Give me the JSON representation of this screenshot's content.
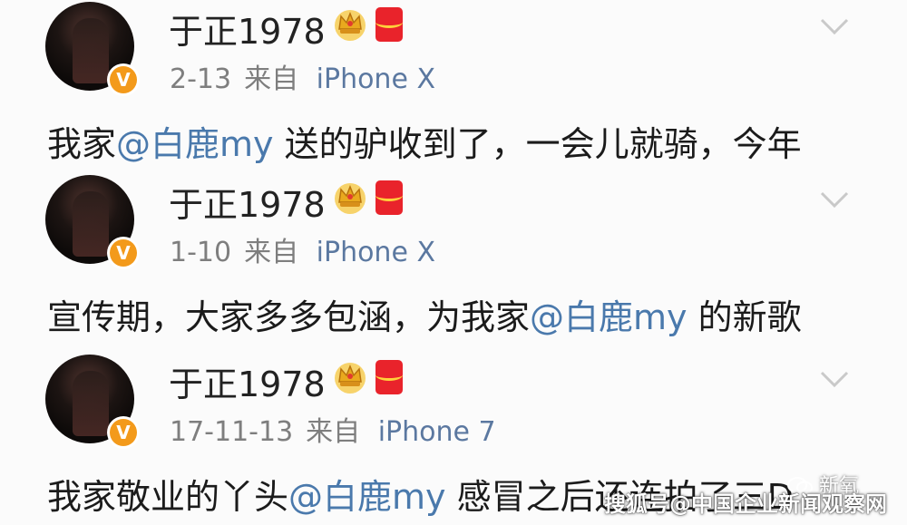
{
  "posts": [
    {
      "username": "于正1978",
      "date": "2-13",
      "source_prefix": "来自",
      "device": "iPhone X",
      "text_before": "我家",
      "mention": "@白鹿my",
      "text_after": " 送的驴收到了，一会儿就骑，今年"
    },
    {
      "username": "于正1978",
      "date": "1-10",
      "source_prefix": "来自",
      "device": "iPhone X",
      "text_before": "宣传期，大家多多包涵，为我家",
      "mention": "@白鹿my",
      "text_after": " 的新歌"
    },
    {
      "username": "于正1978",
      "date": "17-11-13",
      "source_prefix": "来自",
      "device": "iPhone 7",
      "text_before": "我家敬业的丫头",
      "mention": "@白鹿my",
      "text_after": " 感冒之后还连拍了三D"
    }
  ],
  "badge": {
    "verified_letter": "V"
  },
  "icons": {
    "crown": "crown-icon",
    "red_packet": "red-packet-icon",
    "chevron": "chevron-down-icon",
    "verified": "verified-icon"
  },
  "colors": {
    "mention": "#4a79ac",
    "device": "#5b78a0",
    "verified_badge": "#f39a1b",
    "red_packet": "#e9232b"
  },
  "watermark": {
    "wechat_label": "新氧",
    "sohu_label": "搜狐号@中国企业新闻观察网"
  }
}
